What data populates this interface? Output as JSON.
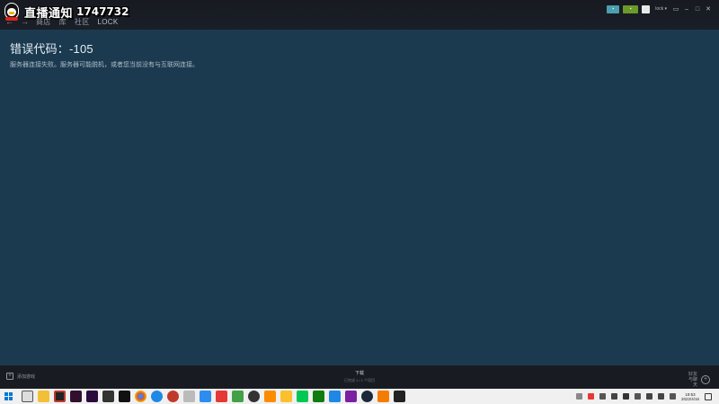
{
  "watermark": {
    "text": "直播通知",
    "number": "1747732"
  },
  "nav": {
    "back": "←",
    "forward": "→",
    "items": [
      "商店",
      "库",
      "社区",
      "LOCK"
    ]
  },
  "header": {
    "user_menu": "lock ▾"
  },
  "error": {
    "title": "错误代码：-105",
    "message": "服务器连接失败。服务器可能脱机，或者您当前没有与互联网连接。"
  },
  "bottom": {
    "add_game": "添加游戏",
    "downloads_label": "下载",
    "downloads_status": "已完成 1 / 1 个项目",
    "friends_chat": "好友与聊天"
  },
  "taskbar": {
    "time": "19:53",
    "date": "2022/4/16"
  },
  "colors": {
    "background": "#1b3a50",
    "header": "#171a21",
    "accent": "#4c9fae"
  }
}
